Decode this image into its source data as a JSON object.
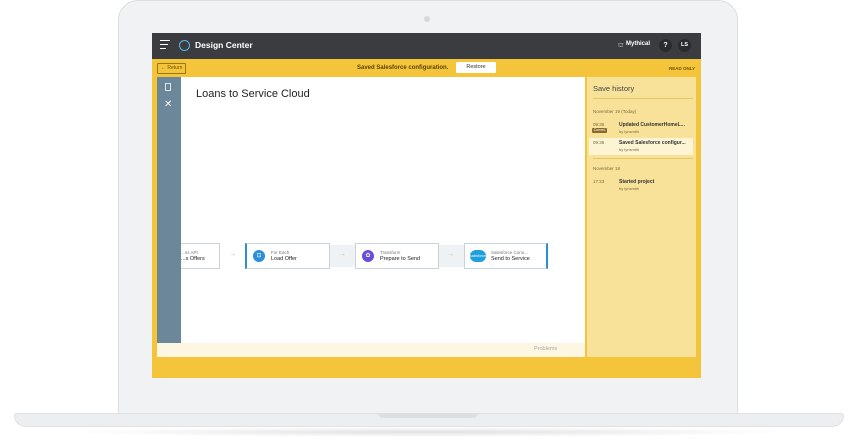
{
  "app": {
    "title": "Design Center",
    "org": "Mythical",
    "help": "?",
    "user_initials": "LS"
  },
  "notice": {
    "return_label": "← Return",
    "message": "Saved Salesforce configuration.",
    "restore_label": "Restore",
    "mode": "READ ONLY"
  },
  "canvas": {
    "title": "Loans to Service Cloud"
  },
  "flow": [
    {
      "type": "...ns API",
      "name": "...s Offers"
    },
    {
      "type": "For Each",
      "name": "Load Offer"
    },
    {
      "type": "Transform",
      "name": "Prepare to Send"
    },
    {
      "type": "Salesforce Conn...",
      "name": "Send to Service",
      "icon_label": "salesforce"
    }
  ],
  "problems": {
    "label": "Problems"
  },
  "history": {
    "title": "Save history",
    "groups": [
      {
        "day": "November 19 (Today)",
        "entries": [
          {
            "time": "09:36",
            "title": "Updated CustomerHomeL...",
            "by": "by lynsmith",
            "badge": "Current"
          },
          {
            "time": "09:36",
            "title": "Saved Salesforce configur...",
            "by": "by lynsmith"
          }
        ]
      },
      {
        "day": "November 18",
        "entries": [
          {
            "time": "17:23",
            "title": "Started project",
            "by": "by lynsmith"
          }
        ]
      }
    ]
  },
  "colors": {
    "accent": "#f4c43a",
    "topbar": "#3b3c3f",
    "rail": "#6c8799",
    "history_bg": "#f8e29a"
  }
}
